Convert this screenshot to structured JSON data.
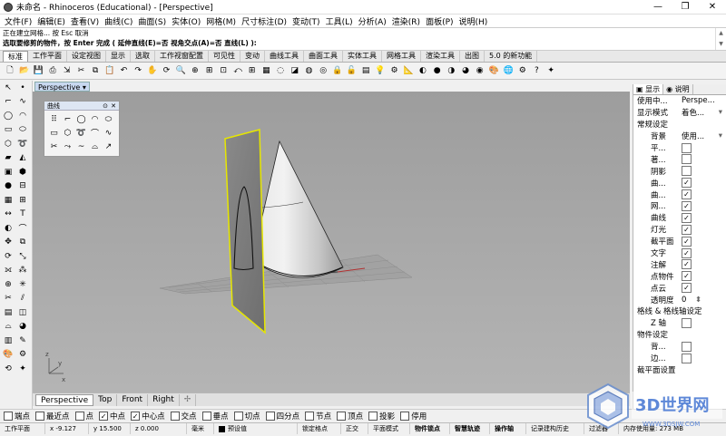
{
  "window": {
    "title": "未命名 - Rhinoceros (Educational) - [Perspective]",
    "controls": [
      "—",
      "❐",
      "✕"
    ]
  },
  "menu": [
    "文件(F)",
    "编辑(E)",
    "查看(V)",
    "曲线(C)",
    "曲面(S)",
    "实体(O)",
    "网格(M)",
    "尺寸标注(D)",
    "变动(T)",
    "工具(L)",
    "分析(A)",
    "渲染(R)",
    "面板(P)",
    "说明(H)"
  ],
  "command": {
    "history": "正在建立网格... 按 Esc 取消",
    "prompt": "选取要修剪的物件，按 Enter 完成 ( 延伸直线(E)=否  视角交点(A)=否  直线(L) ):"
  },
  "toolbar_tabs": [
    "标准",
    "工作平面",
    "设定视图",
    "显示",
    "选取",
    "工作视窗配置",
    "可见性",
    "变动",
    "曲线工具",
    "曲面工具",
    "实体工具",
    "网格工具",
    "渲染工具",
    "出图",
    "5.0 的新功能"
  ],
  "active_toolbar_tab": "标准",
  "viewport": {
    "active_label": "Perspective",
    "dropdown_glyph": "▾",
    "axis_x": "x",
    "axis_y": "y",
    "axis_z": "z"
  },
  "float_panel": {
    "title": "曲线",
    "pin": "⊙",
    "close": "✕"
  },
  "viewport_tabs": [
    "Perspective",
    "Top",
    "Front",
    "Right"
  ],
  "viewport_tab_add": "✢",
  "osnaps": [
    {
      "label": "端点",
      "checked": false
    },
    {
      "label": "最近点",
      "checked": false
    },
    {
      "label": "点",
      "checked": false
    },
    {
      "label": "中点",
      "checked": true
    },
    {
      "label": "中心点",
      "checked": true
    },
    {
      "label": "交点",
      "checked": false
    },
    {
      "label": "垂点",
      "checked": false
    },
    {
      "label": "切点",
      "checked": false
    },
    {
      "label": "四分点",
      "checked": false
    },
    {
      "label": "节点",
      "checked": false
    },
    {
      "label": "顶点",
      "checked": false
    },
    {
      "label": "投影",
      "checked": false
    },
    {
      "label": "停用",
      "checked": false
    }
  ],
  "status": {
    "cplane": "工作平面",
    "x": "x -9.127",
    "y": "y 15.500",
    "z": "z 0.000",
    "unit": "毫米",
    "layer": "预设值",
    "grid_snap": "锁定格点",
    "ortho": "正交",
    "planar": "平面模式",
    "osnap": "物件锁点",
    "smarttrack": "智慧轨迹",
    "gumball": "操作轴",
    "history": "记录建构历史",
    "filter": "过滤器",
    "memory": "内存使用量: 273 MB"
  },
  "right_panel": {
    "tabs": [
      "显示",
      "说明"
    ],
    "rows": [
      {
        "label": "使用中...",
        "value": "Perspe...",
        "type": "kv"
      },
      {
        "label": "显示模式",
        "value": "着色...",
        "type": "kv-dd"
      },
      {
        "label": "常规设定",
        "type": "section"
      },
      {
        "label": "背景",
        "value": "使用...",
        "type": "kv-dd-indent"
      },
      {
        "label": "平...",
        "checked": false,
        "type": "check"
      },
      {
        "label": "著...",
        "checked": false,
        "type": "check"
      },
      {
        "label": "阴影",
        "checked": false,
        "type": "check"
      },
      {
        "label": "曲...",
        "checked": true,
        "type": "check"
      },
      {
        "label": "曲...",
        "checked": true,
        "type": "check"
      },
      {
        "label": "网...",
        "checked": true,
        "type": "check"
      },
      {
        "label": "曲线",
        "checked": true,
        "type": "check"
      },
      {
        "label": "灯光",
        "checked": true,
        "type": "check"
      },
      {
        "label": "截平面",
        "checked": true,
        "type": "check"
      },
      {
        "label": "文字",
        "checked": true,
        "type": "check"
      },
      {
        "label": "注解",
        "checked": true,
        "type": "check"
      },
      {
        "label": "点物件",
        "checked": true,
        "type": "check"
      },
      {
        "label": "点云",
        "checked": true,
        "type": "check"
      },
      {
        "label": "透明度",
        "value": "0",
        "type": "kv-spin"
      },
      {
        "label": "格线 & 格线轴设定",
        "type": "section"
      },
      {
        "label": "Z 轴",
        "checked": false,
        "type": "check"
      },
      {
        "label": "物件设定",
        "type": "section"
      },
      {
        "label": "背...",
        "checked": false,
        "type": "check"
      },
      {
        "label": "边...",
        "checked": false,
        "type": "check"
      },
      {
        "label": "截平面设置",
        "type": "section"
      }
    ]
  },
  "watermark": {
    "brand": "3D世界网",
    "url": "WWW.3DSJW.COM"
  }
}
